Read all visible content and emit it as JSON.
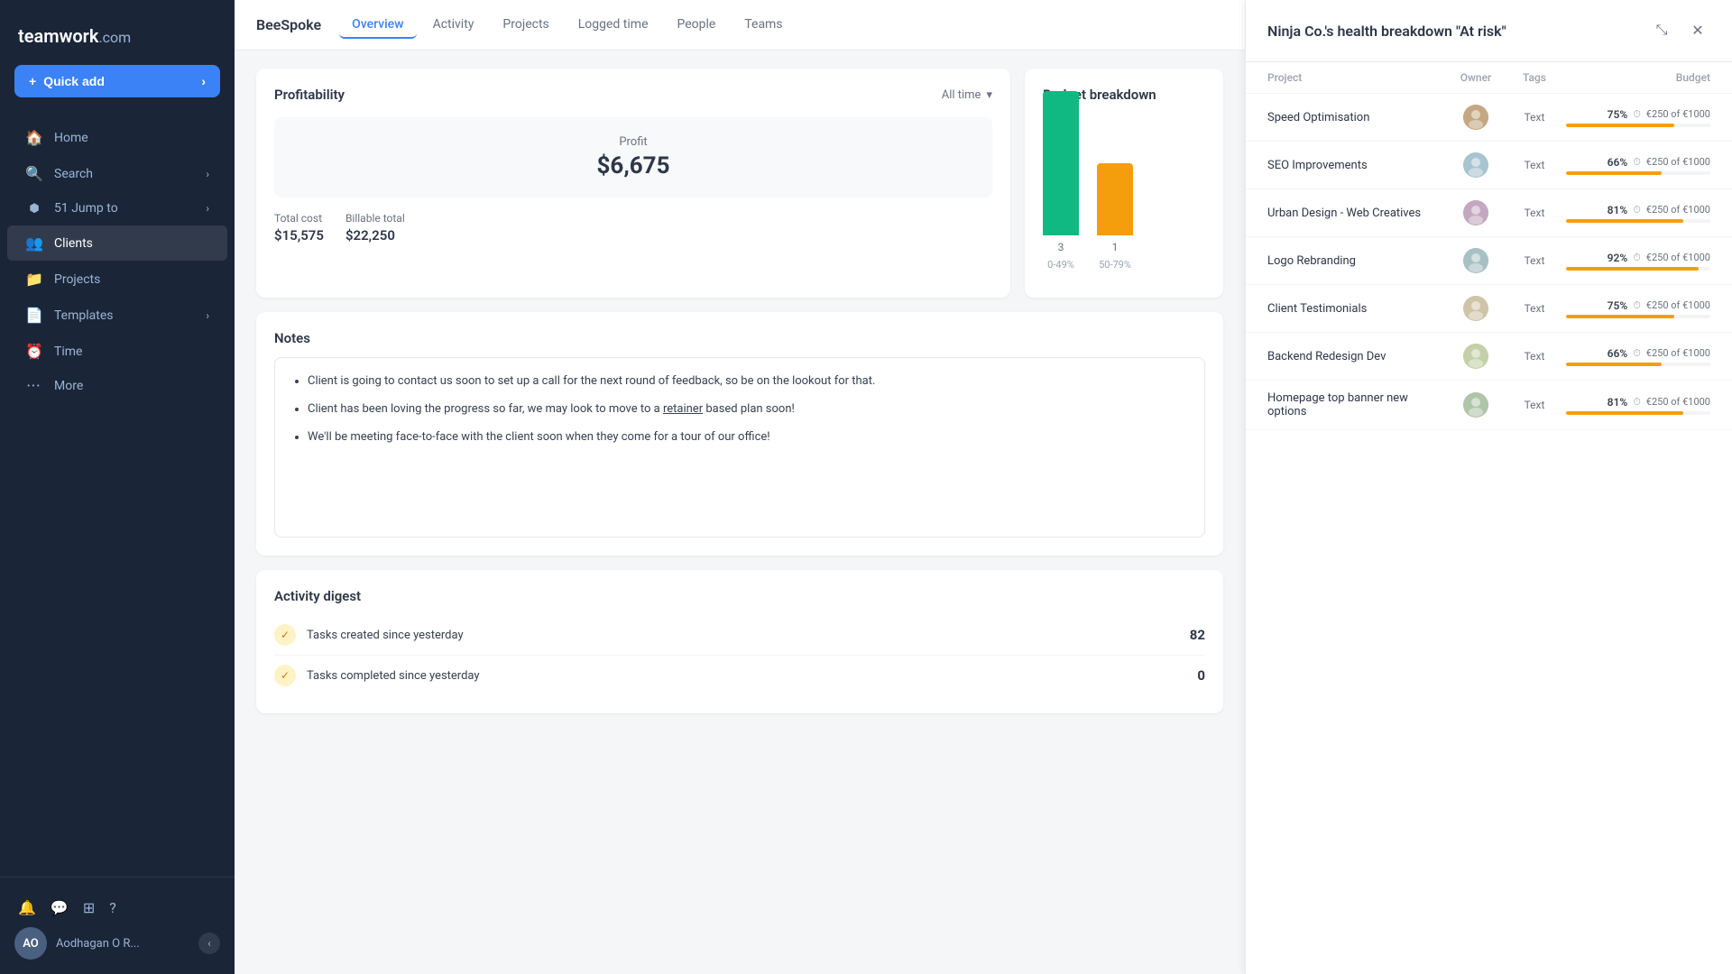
{
  "sidebar": {
    "logo": "teamwork",
    "logo_suffix": ".com",
    "quick_add_label": "Quick add",
    "nav_items": [
      {
        "id": "home",
        "label": "Home",
        "icon": "🏠",
        "active": false
      },
      {
        "id": "search",
        "label": "Search",
        "icon": "🔍",
        "active": false,
        "has_chevron": true
      },
      {
        "id": "jump-to",
        "label": "Jump to",
        "icon": "⬢",
        "active": false,
        "has_chevron": true,
        "badge": "51"
      },
      {
        "id": "clients",
        "label": "Clients",
        "icon": "👥",
        "active": true
      },
      {
        "id": "projects",
        "label": "Projects",
        "icon": "📁",
        "active": false
      },
      {
        "id": "templates",
        "label": "Templates",
        "icon": "📄",
        "active": false,
        "has_chevron": true
      },
      {
        "id": "time",
        "label": "Time",
        "icon": "⏰",
        "active": false
      },
      {
        "id": "more",
        "label": "More",
        "icon": "•••",
        "active": false
      }
    ],
    "footer_icons": [
      "🔔",
      "💬",
      "⊞",
      "?"
    ],
    "user_name": "Aodhagan O R...",
    "user_initials": "AO"
  },
  "top_nav": {
    "project_name": "BeeSpoke",
    "tabs": [
      {
        "id": "overview",
        "label": "Overview",
        "active": true
      },
      {
        "id": "activity",
        "label": "Activity",
        "active": false
      },
      {
        "id": "projects",
        "label": "Projects",
        "active": false
      },
      {
        "id": "logged-time",
        "label": "Logged time",
        "active": false
      },
      {
        "id": "people",
        "label": "People",
        "active": false
      },
      {
        "id": "teams",
        "label": "Teams",
        "active": false
      }
    ]
  },
  "profitability": {
    "title": "Profitability",
    "time_filter": "All time",
    "profit_label": "Profit",
    "profit_value": "$6,675",
    "total_cost_label": "Total cost",
    "total_cost": "$15,575",
    "billable_total_label": "Billable total",
    "billable_total": "$22,250"
  },
  "budget_breakdown": {
    "title": "Budget breakdown",
    "bars": [
      {
        "label": "3",
        "sub_label": "0-49%",
        "color": "green",
        "height": 160
      },
      {
        "label": "1",
        "sub_label": "50-79%",
        "color": "orange",
        "height": 80
      }
    ]
  },
  "notes": {
    "title": "Notes",
    "items": [
      "Client is going to contact us soon to set up a call for the next round of feedback, so be on the lookout for that.",
      "Client has been loving the progress so far, we may look to move to a retainer based plan soon!",
      "We'll be meeting face-to-face with the client soon when they come for a tour of our office!"
    ],
    "retainer_word": "retainer"
  },
  "activity_digest": {
    "title": "Activity digest",
    "items": [
      {
        "label": "Tasks created since yesterday",
        "count": "82"
      },
      {
        "label": "Tasks completed since yesterday",
        "count": "0"
      }
    ]
  },
  "right_panel": {
    "title": "Ninja Co.'s health breakdown \"At risk\"",
    "columns": {
      "project": "Project",
      "owner": "Owner",
      "tags": "Tags",
      "budget": "Budget"
    },
    "rows": [
      {
        "project": "Speed Optimisation",
        "tags": "Text",
        "pct": "75%",
        "amount": "€250 of €1000",
        "bar_pct": 75,
        "bar_color": "yellow"
      },
      {
        "project": "SEO Improvements",
        "tags": "Text",
        "pct": "66%",
        "amount": "€250 of €1000",
        "bar_pct": 66,
        "bar_color": "yellow"
      },
      {
        "project": "Urban Design - Web Creatives",
        "tags": "Text",
        "pct": "81%",
        "amount": "€250 of €1000",
        "bar_pct": 81,
        "bar_color": "yellow"
      },
      {
        "project": "Logo Rebranding",
        "tags": "Text",
        "pct": "92%",
        "amount": "€250 of €1000",
        "bar_pct": 92,
        "bar_color": "yellow"
      },
      {
        "project": "Client Testimonials",
        "tags": "Text",
        "pct": "75%",
        "amount": "€250 of €1000",
        "bar_pct": 75,
        "bar_color": "yellow"
      },
      {
        "project": "Backend Redesign Dev",
        "tags": "Text",
        "pct": "66%",
        "amount": "€250 of €1000",
        "bar_pct": 66,
        "bar_color": "yellow"
      },
      {
        "project": "Homepage top banner new options",
        "tags": "Text",
        "pct": "81%",
        "amount": "€250 of €1000",
        "bar_pct": 81,
        "bar_color": "yellow"
      }
    ]
  }
}
